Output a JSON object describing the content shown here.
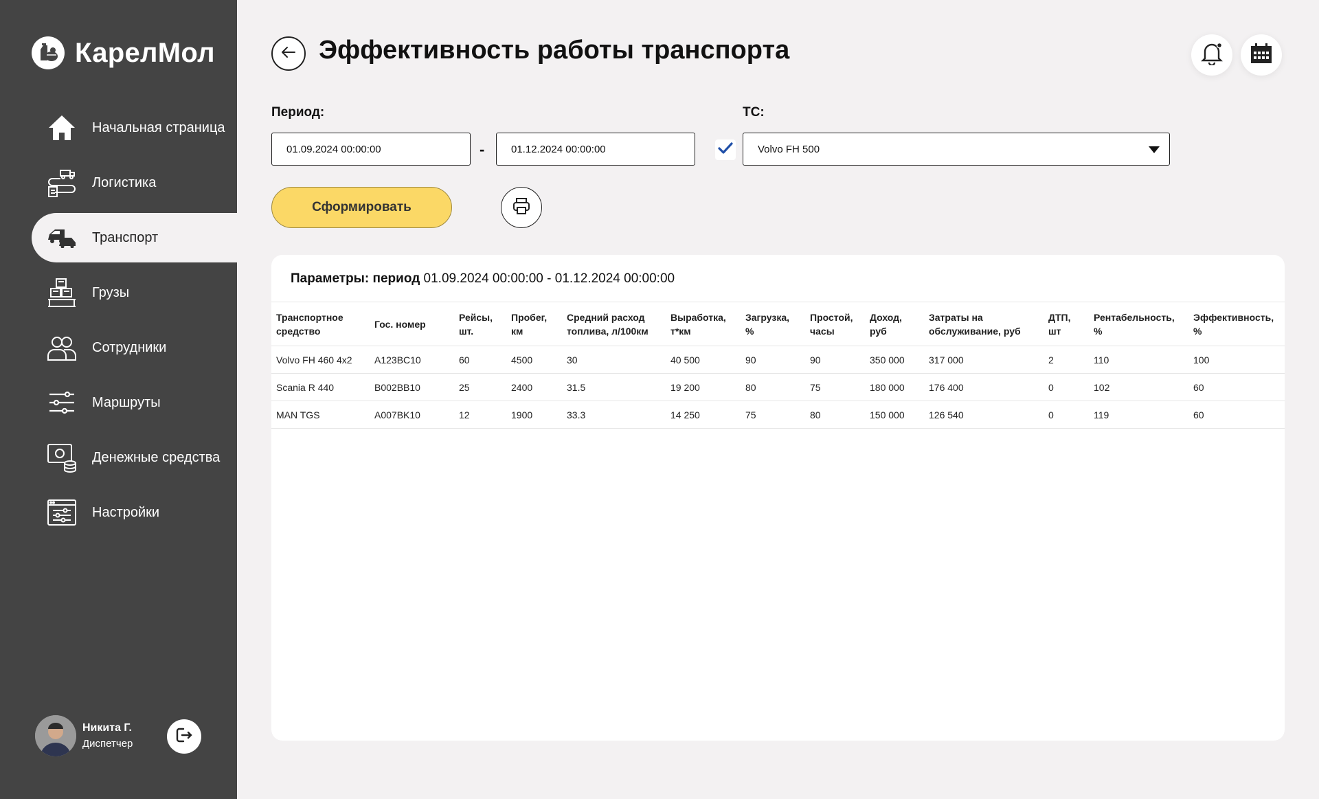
{
  "app": {
    "name": "КарелМол"
  },
  "sidebar": {
    "items": [
      {
        "label": "Начальная страница",
        "icon": "home-icon"
      },
      {
        "label": "Логистика",
        "icon": "logistics-icon"
      },
      {
        "label": "Транспорт",
        "icon": "vehicles-icon",
        "active": true
      },
      {
        "label": "Грузы",
        "icon": "cargo-icon"
      },
      {
        "label": "Сотрудники",
        "icon": "employees-icon"
      },
      {
        "label": "Маршруты",
        "icon": "routes-icon"
      },
      {
        "label": "Денежные средства",
        "icon": "money-icon"
      },
      {
        "label": "Настройки",
        "icon": "settings-icon"
      }
    ]
  },
  "user": {
    "name": "Никита Г.",
    "role": "Диспетчер"
  },
  "header": {
    "title": "Эффективность работы транспорта"
  },
  "filters": {
    "period_label": "Период:",
    "date_from": "01.09.2024 00:00:00",
    "separator": "-",
    "date_to": "01.12.2024 00:00:00",
    "vehicle_label": "ТС:",
    "vehicle_checked": true,
    "vehicle_value": "Volvo FH 500"
  },
  "actions": {
    "generate_label": "Сформировать"
  },
  "report": {
    "params_label": "Параметры: период",
    "params_value": "01.09.2024 00:00:00 - 01.12.2024 00:00:00",
    "columns": [
      [
        "Транспортное",
        "средство"
      ],
      [
        "Гос. номер",
        ""
      ],
      [
        "Рейсы,",
        "шт."
      ],
      [
        "Пробег,",
        "км"
      ],
      [
        "Средний расход",
        "топлива, л/100км"
      ],
      [
        "Выработка,",
        "т*км"
      ],
      [
        "Загрузка,",
        "%"
      ],
      [
        "Простой,",
        "часы"
      ],
      [
        "Доход,",
        "руб"
      ],
      [
        "Затраты на",
        "обслуживание, руб"
      ],
      [
        "ДТП,",
        "шт"
      ],
      [
        "Рентабельность,",
        "%"
      ],
      [
        "Эффективность,",
        "%"
      ]
    ],
    "rows": [
      [
        "Volvo FH 460 4x2",
        "A123BC10",
        "60",
        "4500",
        "30",
        "40 500",
        "90",
        "90",
        "350 000",
        "317 000",
        "2",
        "110",
        "100"
      ],
      [
        "Scania R 440",
        "B002BB10",
        "25",
        "2400",
        "31.5",
        "19 200",
        "80",
        "75",
        "180 000",
        "176 400",
        "0",
        "102",
        "60"
      ],
      [
        "MAN TGS",
        "A007BK10",
        "12",
        "1900",
        "33.3",
        "14 250",
        "75",
        "80",
        "150 000",
        "126 540",
        "0",
        "119",
        "60"
      ]
    ]
  },
  "colors": {
    "sidebar_bg": "#444444",
    "page_bg": "#f3f1f2",
    "accent_yellow": "#fbd866",
    "check_blue": "#1f4fa8"
  }
}
